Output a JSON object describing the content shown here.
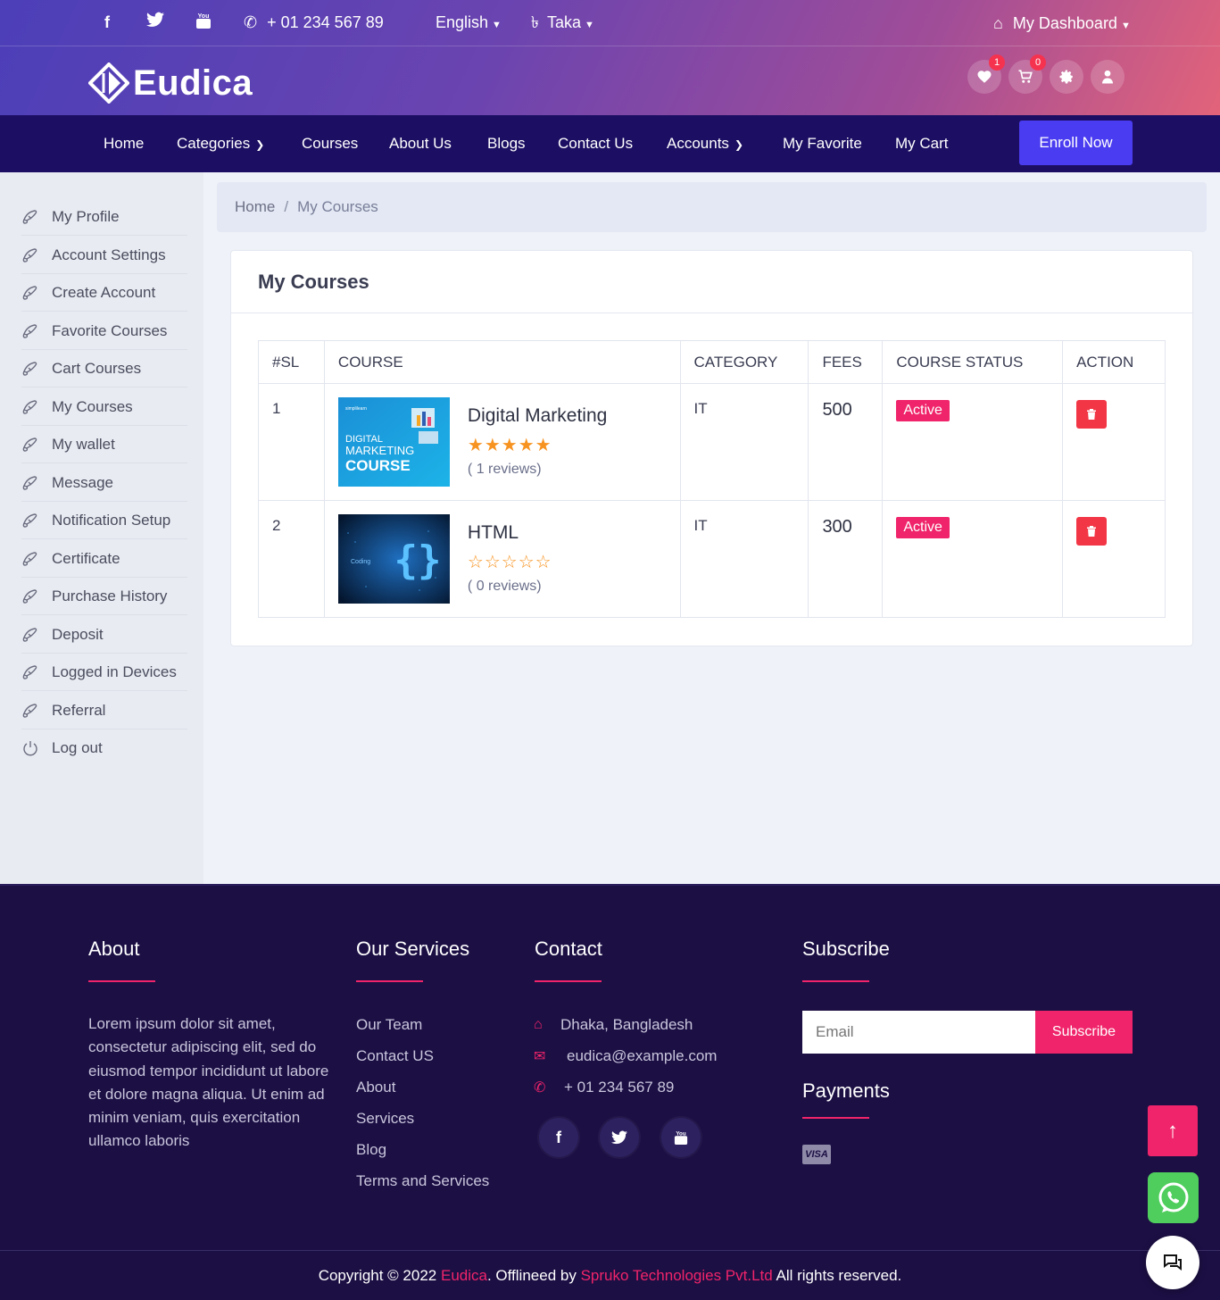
{
  "topbar": {
    "facebook_icon": "f",
    "twitter_icon": "twitter",
    "youtube_icon": "youtube",
    "phone": "+ 01 234 567 89",
    "language": "English",
    "currency": "Taka",
    "currency_symbol": "৳",
    "dashboard": "My Dashboard"
  },
  "brand": {
    "name": "Eudica"
  },
  "header_icons": {
    "favorites_count": "1",
    "cart_count": "0"
  },
  "nav": {
    "items": [
      "Home",
      "Categories",
      "Courses",
      "About Us",
      "Blogs",
      "Contact Us",
      "Accounts",
      "My Favorite",
      "My Cart"
    ],
    "enroll": "Enroll Now"
  },
  "sidebar": {
    "items": [
      "My Profile",
      "Account Settings",
      "Create Account",
      "Favorite Courses",
      "Cart Courses",
      "My Courses",
      "My wallet",
      "Message",
      "Notification Setup",
      "Certificate",
      "Purchase History",
      "Deposit",
      "Logged in Devices",
      "Referral",
      "Log out"
    ]
  },
  "breadcrumb": {
    "home": "Home",
    "separator": "/",
    "current": "My Courses"
  },
  "card": {
    "title": "My Courses",
    "columns": [
      "#SL",
      "COURSE",
      "CATEGORY",
      "FEES",
      "COURSE STATUS",
      "ACTION"
    ],
    "rows": [
      {
        "sl": "1",
        "name": "Digital Marketing",
        "rating": 5,
        "stars": "★★★★★",
        "reviews": "( 1 reviews)",
        "category": "IT",
        "fees": "500",
        "status": "Active",
        "thumb_text": [
          "simplilearn",
          "DIGITAL",
          "MARKETING",
          "COURSE"
        ]
      },
      {
        "sl": "2",
        "name": "HTML",
        "rating": 0,
        "stars": "☆☆☆☆☆",
        "reviews": "( 0 reviews)",
        "category": "IT",
        "fees": "300",
        "status": "Active",
        "thumb_text": [
          "Coding"
        ]
      }
    ]
  },
  "footer": {
    "about_title": "About",
    "about_text": "Lorem ipsum dolor sit amet, consectetur adipiscing elit, sed do eiusmod tempor incididunt ut labore et dolore magna aliqua. Ut enim ad minim veniam, quis exercitation ullamco laboris",
    "services_title": "Our Services",
    "services": [
      "Our Team",
      "Contact US",
      "About",
      "Services",
      "Blog",
      "Terms and Services"
    ],
    "contact_title": "Contact",
    "address": "Dhaka, Bangladesh",
    "email": "eudica@example.com",
    "phone": "+ 01 234 567 89",
    "subscribe_title": "Subscribe",
    "email_placeholder": "Email",
    "subscribe_button": "Subscribe",
    "payments_title": "Payments",
    "visa": "VISA",
    "copyright_pre": "Copyright © 2022 ",
    "brand": "Eudica",
    "copyright_mid": ". Offlineed by ",
    "company": "Spruko Technologies Pvt.Ltd",
    "copyright_post": " All rights reserved."
  },
  "colors": {
    "accent": "#f0246a",
    "nav_bg": "#1c0f63",
    "footer_bg": "#1c0f44",
    "enroll": "#4a3cf0"
  }
}
